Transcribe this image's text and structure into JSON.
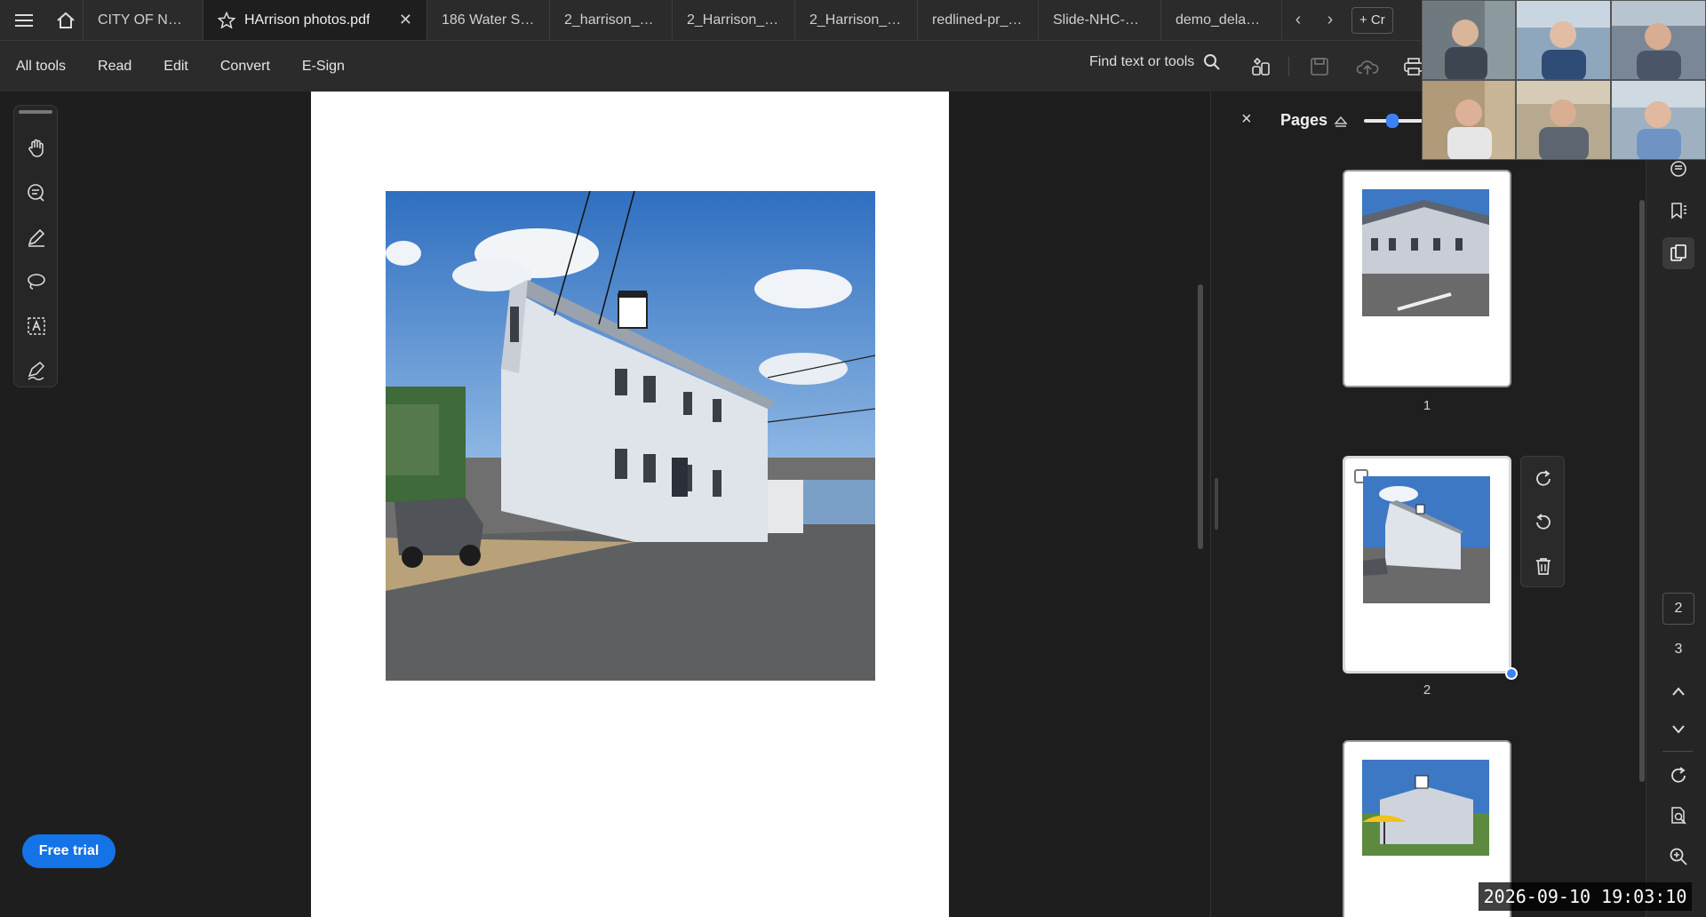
{
  "tabs": [
    {
      "label": "CITY OF NEW..."
    },
    {
      "label": "HArrison photos.pdf",
      "active": true
    },
    {
      "label": "186 Water St - ..."
    },
    {
      "label": "2_harrison_str..."
    },
    {
      "label": "2_Harrison_St..."
    },
    {
      "label": "2_Harrison_St..."
    },
    {
      "label": "redlined-pr_lo..."
    },
    {
      "label": "Slide-NHC-Me..."
    },
    {
      "label": "demo_delay_..."
    }
  ],
  "new_tab_label": "+ Cr",
  "menu": [
    "All tools",
    "Read",
    "Edit",
    "Convert",
    "E-Sign"
  ],
  "find_label": "Find text or tools",
  "free_trial_label": "Free trial",
  "panel": {
    "title": "Pages",
    "close_label": "×",
    "zoom_slider_fraction": 0.45,
    "pages": [
      {
        "number": "1"
      },
      {
        "number": "2",
        "selected": true
      },
      {
        "number": ""
      }
    ]
  },
  "rail": {
    "current_page": "2",
    "next_page": "3"
  },
  "timestamp": "2026-09-10  19:03:10",
  "colors": {
    "accent": "#1473e6",
    "bg": "#1e1e1e",
    "chrome": "#2b2b2b"
  }
}
